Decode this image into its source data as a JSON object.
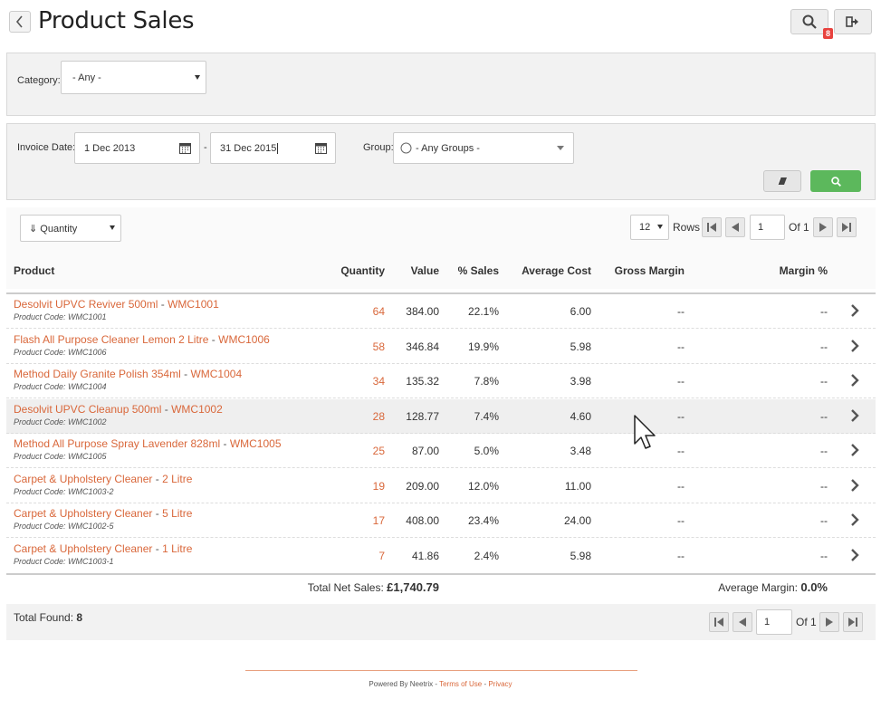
{
  "header": {
    "title": "Product Sales",
    "notification_count": "8"
  },
  "filters": {
    "category_label": "Category:",
    "category_value": "- Any -",
    "invoice_date_label": "Invoice Date:",
    "date_from": "1 Dec 2013",
    "date_separator": "-",
    "date_to": "31 Dec 2015",
    "group_label": "Group:",
    "group_value": "- Any Groups -"
  },
  "toolbar": {
    "sort_value": "⇓ Quantity",
    "rows_value": "12",
    "rows_label": "Rows",
    "page_value": "1",
    "page_of": "Of 1"
  },
  "table": {
    "columns": [
      "Product",
      "Quantity",
      "Value",
      "% Sales",
      "Average Cost",
      "Gross Margin",
      "Margin %"
    ],
    "code_prefix": "Product Code: ",
    "rows": [
      {
        "name": "Desolvit UPVC Reviver 500ml",
        "sep": " - ",
        "code": "WMC1001",
        "code_line": "Product Code: WMC1001",
        "qty": "64",
        "value": "384.00",
        "sales": "22.1%",
        "avg_cost": "6.00",
        "gross": "--",
        "margin": "--"
      },
      {
        "name": "Flash All Purpose Cleaner Lemon 2 Litre",
        "sep": " - ",
        "code": "WMC1006",
        "code_line": "Product Code: WMC1006",
        "qty": "58",
        "value": "346.84",
        "sales": "19.9%",
        "avg_cost": "5.98",
        "gross": "--",
        "margin": "--"
      },
      {
        "name": "Method Daily Granite Polish 354ml",
        "sep": " - ",
        "code": "WMC1004",
        "code_line": "Product Code: WMC1004",
        "qty": "34",
        "value": "135.32",
        "sales": "7.8%",
        "avg_cost": "3.98",
        "gross": "--",
        "margin": "--"
      },
      {
        "name": "Desolvit UPVC Cleanup 500ml",
        "sep": " - ",
        "code": "WMC1002",
        "code_line": "Product Code: WMC1002",
        "qty": "28",
        "value": "128.77",
        "sales": "7.4%",
        "avg_cost": "4.60",
        "gross": "--",
        "margin": "--"
      },
      {
        "name": "Method All Purpose Spray Lavender 828ml",
        "sep": " - ",
        "code": "WMC1005",
        "code_line": "Product Code: WMC1005",
        "qty": "25",
        "value": "87.00",
        "sales": "5.0%",
        "avg_cost": "3.48",
        "gross": "--",
        "margin": "--"
      },
      {
        "name": "Carpet & Upholstery Cleaner",
        "sep": " - ",
        "code": "2 Litre",
        "code_line": "Product Code: WMC1003-2",
        "qty": "19",
        "value": "209.00",
        "sales": "12.0%",
        "avg_cost": "11.00",
        "gross": "--",
        "margin": "--"
      },
      {
        "name": "Carpet & Upholstery Cleaner",
        "sep": " - ",
        "code": "5 Litre",
        "code_line": "Product Code: WMC1002-5",
        "qty": "17",
        "value": "408.00",
        "sales": "23.4%",
        "avg_cost": "24.00",
        "gross": "--",
        "margin": "--"
      },
      {
        "name": "Carpet & Upholstery Cleaner",
        "sep": " - ",
        "code": "1 Litre",
        "code_line": "Product Code: WMC1003-1",
        "qty": "7",
        "value": "41.86",
        "sales": "2.4%",
        "avg_cost": "5.98",
        "gross": "--",
        "margin": "--"
      }
    ]
  },
  "totals": {
    "net_label": "Total Net Sales:",
    "net_value": "£1,740.79",
    "margin_label": "Average Margin:",
    "margin_value": "0.0%"
  },
  "footer": {
    "found_label": "Total Found:",
    "found_value": "8",
    "page_value": "1",
    "page_of": "Of 1",
    "powered_by": "Powered By Neetrix",
    "dash1": " - ",
    "terms": "Terms of Use",
    "dash2": " - ",
    "privacy": "Privacy"
  },
  "colors": {
    "accent": "#d9673a",
    "search_button": "#5cb85c",
    "badge": "#e8423e"
  }
}
